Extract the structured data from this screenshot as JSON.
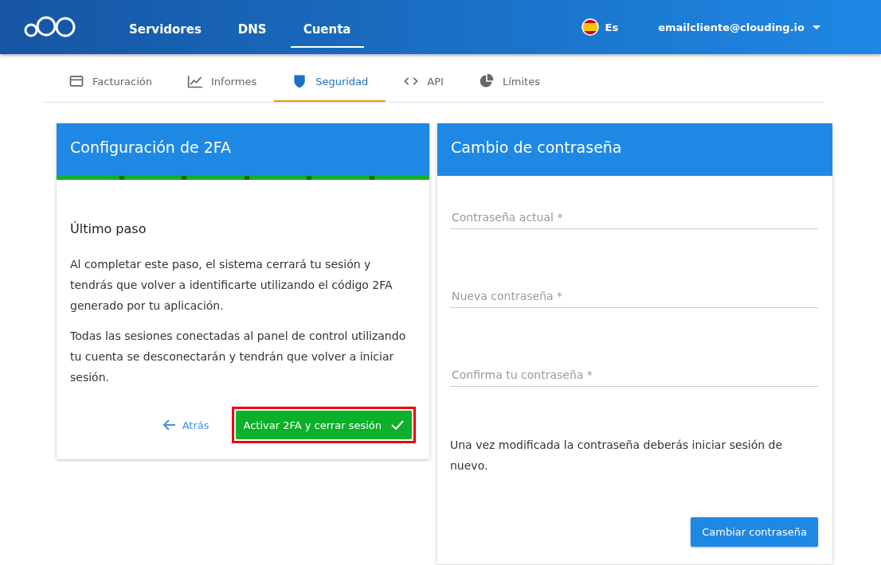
{
  "topbar": {
    "nav": [
      {
        "label": "Servidores",
        "selected": false
      },
      {
        "label": "DNS",
        "selected": false
      },
      {
        "label": "Cuenta",
        "selected": true
      }
    ],
    "language": "Es",
    "account": "emailcliente@clouding.io"
  },
  "tabs": [
    {
      "label": "Facturación",
      "kind": "card",
      "selected": false
    },
    {
      "label": "Informes",
      "kind": "chart",
      "selected": false
    },
    {
      "label": "Seguridad",
      "kind": "shield",
      "selected": true
    },
    {
      "label": "API",
      "kind": "code",
      "selected": false
    },
    {
      "label": "Límites",
      "kind": "pie",
      "selected": false
    }
  ],
  "twofa": {
    "title": "Configuración de 2FA",
    "progress": {
      "level": 1
    },
    "heading": "Último paso",
    "paragraphs": [
      "Al completar este paso, el sistema cerrará tu sesión y tendrás que volver a identificarte utilizando el código 2FA generado por tu aplicación.",
      "Todas las sesiones conectadas al panel de control utilizando tu cuenta se desconectarán y tendrán que volver a iniciar sesión."
    ],
    "back": "Atrás",
    "submit": {
      "label": "Activar 2FA y cerrar sesión",
      "highlighted": true
    }
  },
  "password": {
    "title": "Cambio de contraseña",
    "fields": [
      {
        "placeholder": "Contraseña actual *"
      },
      {
        "placeholder": "Nueva contraseña *"
      },
      {
        "placeholder": "Confirma tu contraseña *"
      }
    ],
    "note": "Una vez modificada la contraseña deberás iniciar sesión de nuevo.",
    "button": "Cambiar contraseña"
  }
}
